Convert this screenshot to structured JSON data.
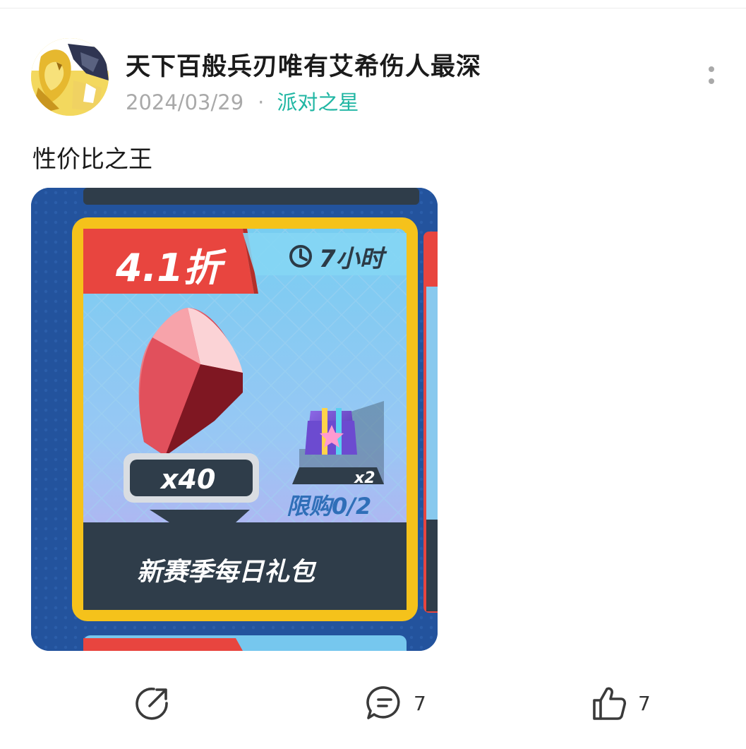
{
  "post": {
    "author": "天下百般兵刃唯有艾希伤人最深",
    "date": "2024/03/29",
    "separator": "·",
    "topic": "派对之星",
    "text": "性价比之王"
  },
  "image": {
    "discount": "4.1折",
    "timer": "7小时",
    "gem_count": "x40",
    "chest_count": "x2",
    "limit": "限购0/2",
    "title": "新赛季每日礼包"
  },
  "actions": {
    "comments": "7",
    "likes": "7"
  },
  "colors": {
    "topic": "#20b6a3",
    "meta": "#a9a9a9",
    "card_border": "#f5c21b",
    "discount_banner": "#e8453f"
  }
}
